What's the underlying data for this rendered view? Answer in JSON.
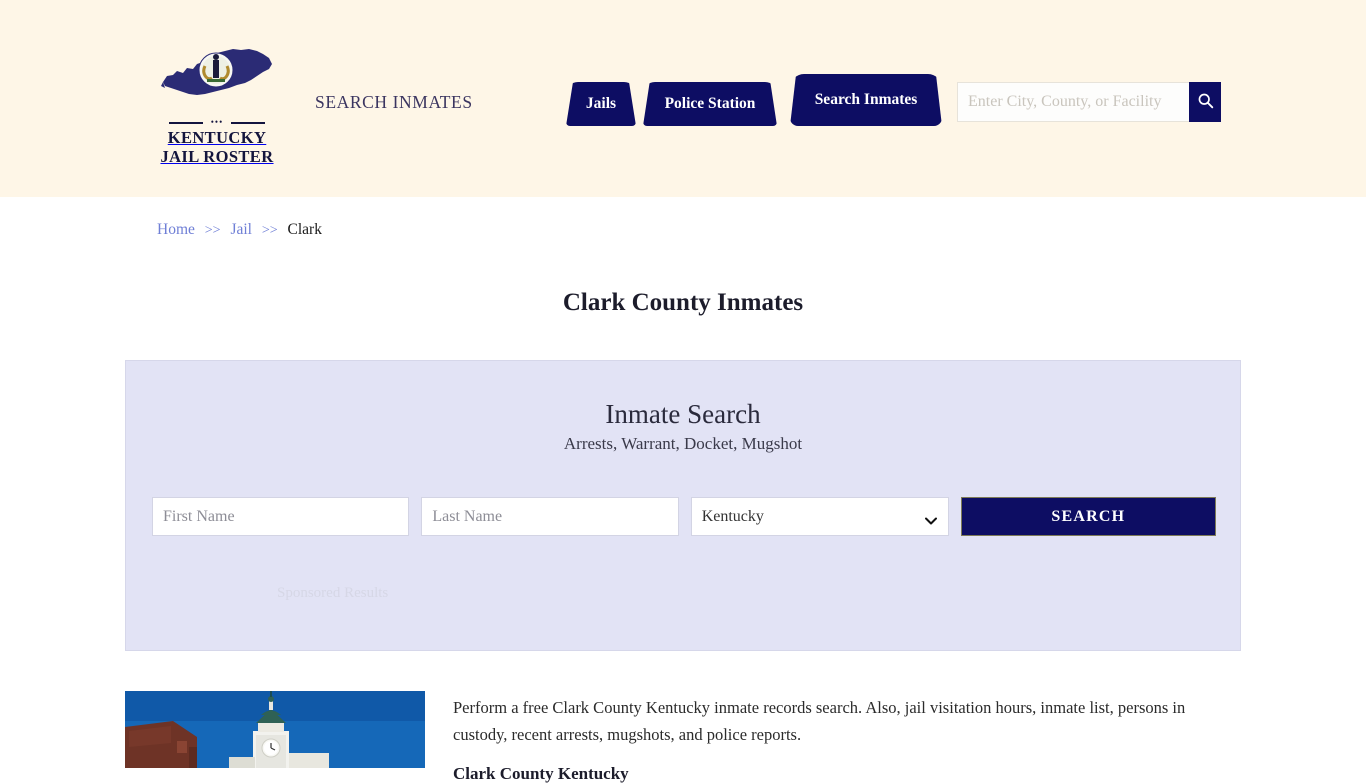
{
  "header": {
    "logo": {
      "line1": "KENTUCKY",
      "line2": "JAIL ROSTER",
      "map_icon": "kentucky-state-map-icon",
      "seal_icon": "kentucky-state-seal-icon"
    },
    "tagline": "SEARCH INMATES",
    "nav": [
      {
        "label": "Jails",
        "name": "nav-jails"
      },
      {
        "label": "Police Station",
        "name": "nav-police-station"
      },
      {
        "label": "Search Inmates",
        "name": "nav-search-inmates"
      }
    ],
    "search": {
      "placeholder": "Enter City, County, or Facility",
      "value": "",
      "button_icon": "search-icon"
    },
    "background_color": "#FEF6E7",
    "accent_color": "#0d0d63"
  },
  "breadcrumb": {
    "items": [
      {
        "label": "Home",
        "link": true
      },
      {
        "label": "Jail",
        "link": true
      },
      {
        "label": "Clark",
        "link": false
      }
    ],
    "separator": ">>",
    "link_color": "#6f7fd6"
  },
  "page": {
    "title": "Clark County Inmates"
  },
  "search_panel": {
    "title": "Inmate Search",
    "subtitle": "Arrests, Warrant, Docket, Mugshot",
    "first_name": {
      "placeholder": "First Name",
      "value": ""
    },
    "last_name": {
      "placeholder": "Last Name",
      "value": ""
    },
    "state": {
      "selected": "Kentucky",
      "options": [
        "Kentucky"
      ],
      "caret_icon": "chevron-down-icon"
    },
    "submit_label": "SEARCH",
    "sponsored_label": "Sponsored Results",
    "background_color": "#E2E3F5"
  },
  "content": {
    "photo_alt": "clark-county-courthouse-photo",
    "paragraph": "Perform a free Clark County Kentucky inmate records search. Also, jail visitation hours, inmate list, persons in custody, recent arrests, mugshots, and police reports.",
    "subheading": "Clark County Kentucky"
  }
}
